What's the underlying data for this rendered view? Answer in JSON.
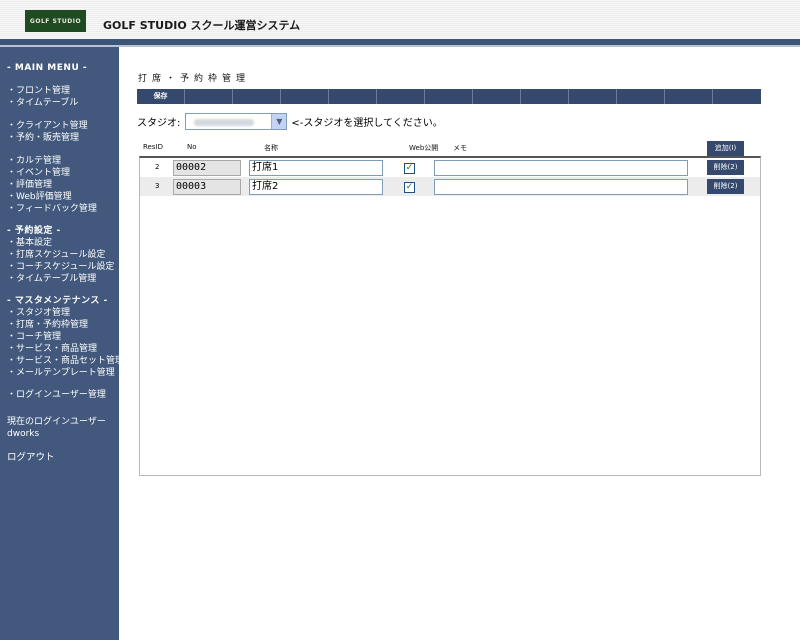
{
  "header": {
    "logo_text": "GOLF STUDIO",
    "app_title": "GOLF STUDIO スクール運営システム"
  },
  "sidebar": {
    "main_menu": "- MAIN MENU -",
    "items": [
      "・フロント管理",
      "・タイムテーブル",
      "・クライアント管理",
      "・予約・販売管理",
      "・カルテ管理",
      "・イベント管理",
      "・評価管理",
      "・Web評価管理",
      "・フィードバック管理"
    ],
    "reservation_head": "- 予約設定 -",
    "reservation_items": [
      "・基本設定",
      "・打席スケジュール設定",
      "・コーチスケジュール設定",
      "・タイムテーブル管理"
    ],
    "master_head": "- マスタメンテナンス -",
    "master_items": [
      "・スタジオ管理",
      "・打席・予約枠管理",
      "・コーチ管理",
      "・サービス・商品管理",
      "・サービス・商品セット管理",
      "・メールテンプレート管理"
    ],
    "login_user_mgmt": "・ログインユーザー管理",
    "current_user_label": "現在のログインユーザー",
    "current_user": "dworks",
    "logout": "ログアウト"
  },
  "main": {
    "page_title": "打席・予約枠管理",
    "save_label": "保存",
    "studio_label": "スタジオ:",
    "studio_hint": "<-スタジオを選択してください。",
    "columns": {
      "resid": "ResID",
      "no": "No",
      "name": "名称",
      "web": "Web公開",
      "memo": "メモ"
    },
    "add_label": "追加(I)",
    "rows": [
      {
        "id": "2",
        "no": "00002",
        "name": "打席1",
        "web": true,
        "memo": "",
        "delete_label": "削除(2)"
      },
      {
        "id": "3",
        "no": "00003",
        "name": "打席2",
        "web": true,
        "memo": "",
        "delete_label": "削除(2)"
      }
    ]
  },
  "colors": {
    "sidebar_bg": "#42597d",
    "accent": "#34496d",
    "logo_bg": "#1f4a22"
  }
}
